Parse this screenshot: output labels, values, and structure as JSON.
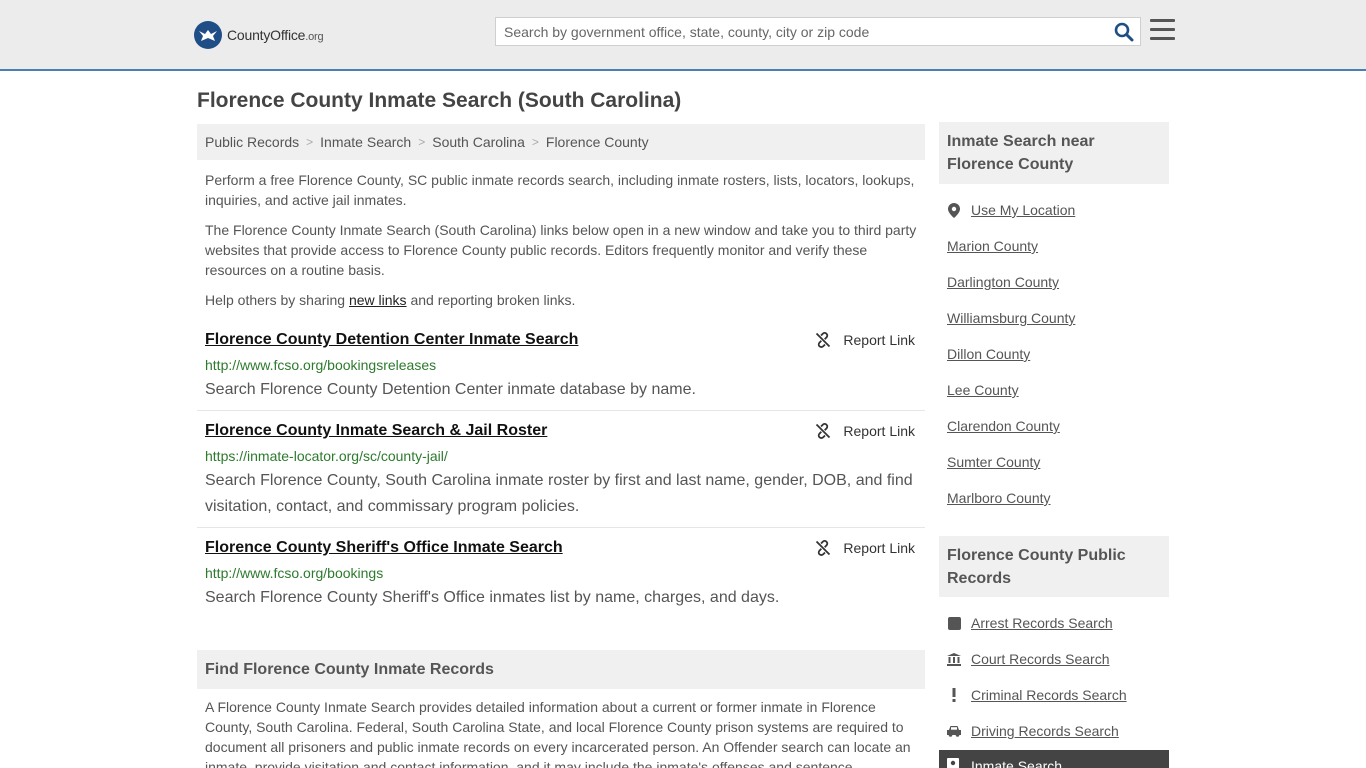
{
  "header": {
    "logo_brand": "CountyOffice",
    "logo_tld": ".org",
    "search_placeholder": "Search by government office, state, county, city or zip code",
    "search_icon": "search-icon",
    "menu_icon": "hamburger-menu-icon"
  },
  "page": {
    "title": "Florence County Inmate Search (South Carolina)"
  },
  "breadcrumb": [
    {
      "label": "Public Records"
    },
    {
      "label": "Inmate Search"
    },
    {
      "label": "South Carolina"
    },
    {
      "label": "Florence County"
    }
  ],
  "intro": {
    "p1": "Perform a free Florence County, SC public inmate records search, including inmate rosters, lists, locators, lookups, inquiries, and active jail inmates.",
    "p2": "The Florence County Inmate Search (South Carolina) links below open in a new window and take you to third party websites that provide access to Florence County public records. Editors frequently monitor and verify these resources on a routine basis.",
    "p3_before": "Help others by sharing ",
    "p3_link": "new links",
    "p3_after": " and reporting broken links."
  },
  "entries": [
    {
      "title": "Florence County Detention Center Inmate Search",
      "url": "http://www.fcso.org/bookingsreleases",
      "description": "Search Florence County Detention Center inmate database by name.",
      "report_label": "Report Link"
    },
    {
      "title": "Florence County Inmate Search & Jail Roster",
      "url": "https://inmate-locator.org/sc/county-jail/",
      "description": "Search Florence County, South Carolina inmate roster by first and last name, gender, DOB, and find visitation, contact, and commissary program policies.",
      "report_label": "Report Link"
    },
    {
      "title": "Florence County Sheriff's Office Inmate Search",
      "url": "http://www.fcso.org/bookings",
      "description": "Search Florence County Sheriff's Office inmates list by name, charges, and days.",
      "report_label": "Report Link"
    }
  ],
  "find_section": {
    "heading": "Find Florence County Inmate Records",
    "body": "A Florence County Inmate Search provides detailed information about a current or former inmate in Florence County, South Carolina. Federal, South Carolina State, and local Florence County prison systems are required to document all prisoners and public inmate records on every incarcerated person. An Offender search can locate an inmate, provide visitation and contact information, and it may include the inmate's offenses and sentence"
  },
  "sidebar": {
    "nearby_heading": "Inmate Search near Florence County",
    "use_location": "Use My Location",
    "nearby": [
      "Marion County",
      "Darlington County",
      "Williamsburg County",
      "Dillon County",
      "Lee County",
      "Clarendon County",
      "Sumter County",
      "Marlboro County"
    ],
    "records_heading": "Florence County Public Records",
    "records": [
      {
        "label": "Arrest Records Search",
        "icon": "square-icon"
      },
      {
        "label": "Court Records Search",
        "icon": "courthouse-icon"
      },
      {
        "label": "Criminal Records Search",
        "icon": "exclamation-icon"
      },
      {
        "label": "Driving Records Search",
        "icon": "car-icon"
      },
      {
        "label": "Inmate Search",
        "icon": "inmate-icon"
      }
    ]
  },
  "colors": {
    "accent_blue": "#4a7fb3",
    "url_green": "#2d7a2d",
    "logo_blue": "#1f4e86"
  }
}
